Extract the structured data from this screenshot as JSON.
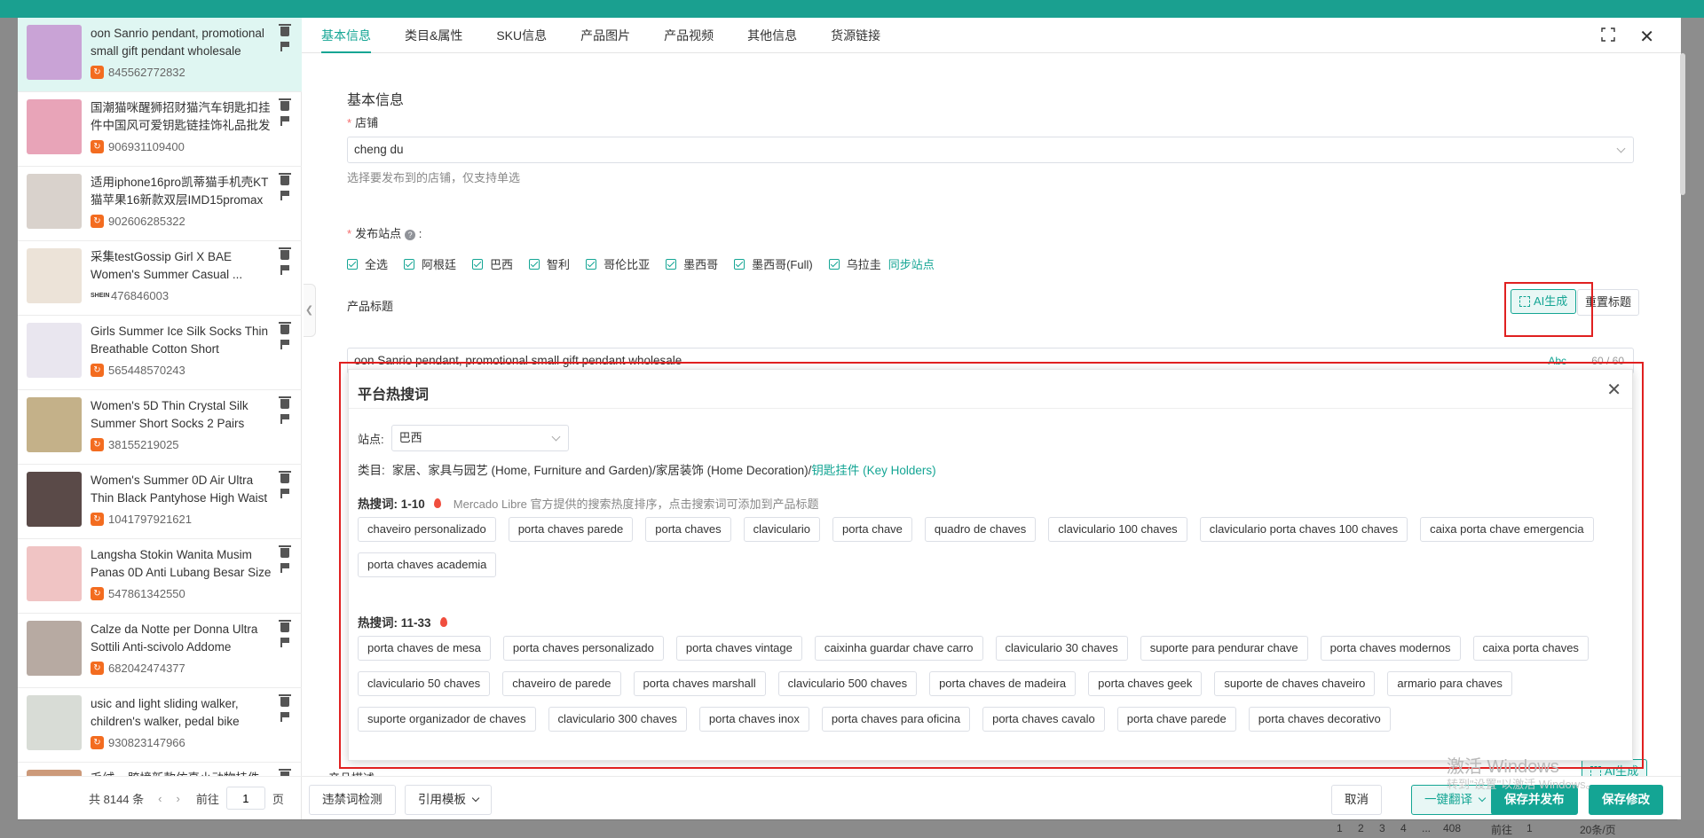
{
  "colors": {
    "accent": "#14a594",
    "danger": "#e02020",
    "source_1688": "#f36c20"
  },
  "products": [
    {
      "title": "oon Sanrio pendant, promotional small gift pendant wholesale",
      "id": "845562772832",
      "source": "1688",
      "thumb": "#c9a3d6",
      "active": true
    },
    {
      "title": "国潮猫咪醒狮招财猫汽车钥匙扣挂件中国风可爱钥匙链挂饰礼品批发",
      "id": "906931109400",
      "source": "1688",
      "thumb": "#e8a4b8"
    },
    {
      "title": "适用iphone16pro凯蒂猫手机壳KT猫苹果16新款双层IMD15promax",
      "id": "902606285322",
      "source": "1688",
      "thumb": "#d9d2cc"
    },
    {
      "title": "采集testGossip Girl X BAE Women's Summer Casual ...",
      "id": "476846003",
      "source": "shein",
      "thumb": "#ece3d8"
    },
    {
      "title": "Girls Summer Ice Silk Socks Thin Breathable Cotton Short",
      "id": "565448570243",
      "source": "1688",
      "thumb": "#e9e6ef"
    },
    {
      "title": "Women's 5D Thin Crystal Silk Summer Short Socks 2 Pairs",
      "id": "38155219025",
      "source": "1688",
      "thumb": "#c4b189"
    },
    {
      "title": "Women's Summer 0D Air Ultra Thin Black Pantyhose High Waist",
      "id": "1041797921621",
      "source": "1688",
      "thumb": "#5a4a48"
    },
    {
      "title": "Langsha Stokin Wanita Musim Panas 0D Anti Lubang Besar Size",
      "id": "547861342550",
      "source": "1688",
      "thumb": "#f0c4c4"
    },
    {
      "title": "Calze da Notte per Donna Ultra Sottili Anti-scivolo Addome",
      "id": "682042474377",
      "source": "1688",
      "thumb": "#b7aaa2"
    },
    {
      "title": "usic and light sliding walker, children's walker, pedal bike",
      "id": "930823147966",
      "source": "1688",
      "thumb": "#d8dcd6"
    },
    {
      "title": "毛绒... 跨境新款仿真小动物挂件",
      "id": "",
      "source": "1688",
      "thumb": "#cc9a7a"
    }
  ],
  "pager": {
    "total": "共 8144 条",
    "prev": "‹",
    "next": "›",
    "goto": "前往",
    "page": "1",
    "unit": "页"
  },
  "tabs": [
    "基本信息",
    "类目&属性",
    "SKU信息",
    "产品图片",
    "产品视频",
    "其他信息",
    "货源链接"
  ],
  "form": {
    "section_title": "基本信息",
    "store_label": "店铺",
    "store_value": "cheng du",
    "store_hint": "选择要发布到的店铺，仅支持单选",
    "site_label": "发布站点",
    "sites": [
      "全选",
      "阿根廷",
      "巴西",
      "智利",
      "哥伦比亚",
      "墨西哥",
      "墨西哥(Full)",
      "乌拉圭"
    ],
    "sync_sites": "同步站点",
    "title_label": "产品标题",
    "ai_btn": "AI生成",
    "reset_title": "重置标题",
    "title_value": "oon Sanrio pendant, promotional small gift pendant wholesale",
    "title_abc": "Abc",
    "title_count": "60 / 60",
    "desc_label": "产品描述:"
  },
  "popup": {
    "title": "平台热搜词",
    "site_label": "站点:",
    "site_value": "巴西",
    "cat_label": "类目:",
    "cat_path": "家居、家具与园艺 (Home, Furniture and Garden)/家居装饰 (Home Decoration)/",
    "cat_leaf": "钥匙挂件 (Key Holders)",
    "hot1_label": "热搜词:  1-10",
    "hot_desc": "Mercado Libre 官方提供的搜索热度排序，点击搜索词可添加到产品标题",
    "hot2_label": "热搜词:  11-33",
    "keywords1": [
      "chaveiro personalizado",
      "porta chaves parede",
      "porta chaves",
      "claviculario",
      "porta chave",
      "quadro de chaves",
      "claviculario 100 chaves",
      "claviculario porta chaves 100 chaves",
      "caixa porta chave emergencia",
      "porta chaves academia"
    ],
    "keywords2": [
      "porta chaves de mesa",
      "porta chaves personalizado",
      "porta chaves vintage",
      "caixinha guardar chave carro",
      "claviculario 30 chaves",
      "suporte para pendurar chave",
      "porta chaves modernos",
      "caixa porta chaves",
      "claviculario 50 chaves",
      "chaveiro de parede",
      "porta chaves marshall",
      "claviculario 500 chaves",
      "porta chaves de madeira",
      "porta chaves geek",
      "suporte de chaves chaveiro",
      "armario para chaves",
      "suporte organizador de chaves",
      "claviculario 300 chaves",
      "porta chaves inox",
      "porta chaves para oficina",
      "porta chaves cavalo",
      "porta chave parede",
      "porta chaves decorativo"
    ]
  },
  "footer": {
    "ban_check": "违禁词检测",
    "template": "引用模板",
    "cancel": "取消",
    "translate": "一键翻译",
    "save_publish": "保存并发布",
    "save": "保存修改"
  },
  "watermark": {
    "line1": "激活 Windows",
    "line2": "转到\"设置\"以激活 Windows。"
  },
  "bg_pager": {
    "a": "1",
    "b": "2",
    "c": "3",
    "d": "4",
    "e": "...",
    "f": "408",
    "g": "前往",
    "h": "1",
    "i": "20条/页"
  }
}
